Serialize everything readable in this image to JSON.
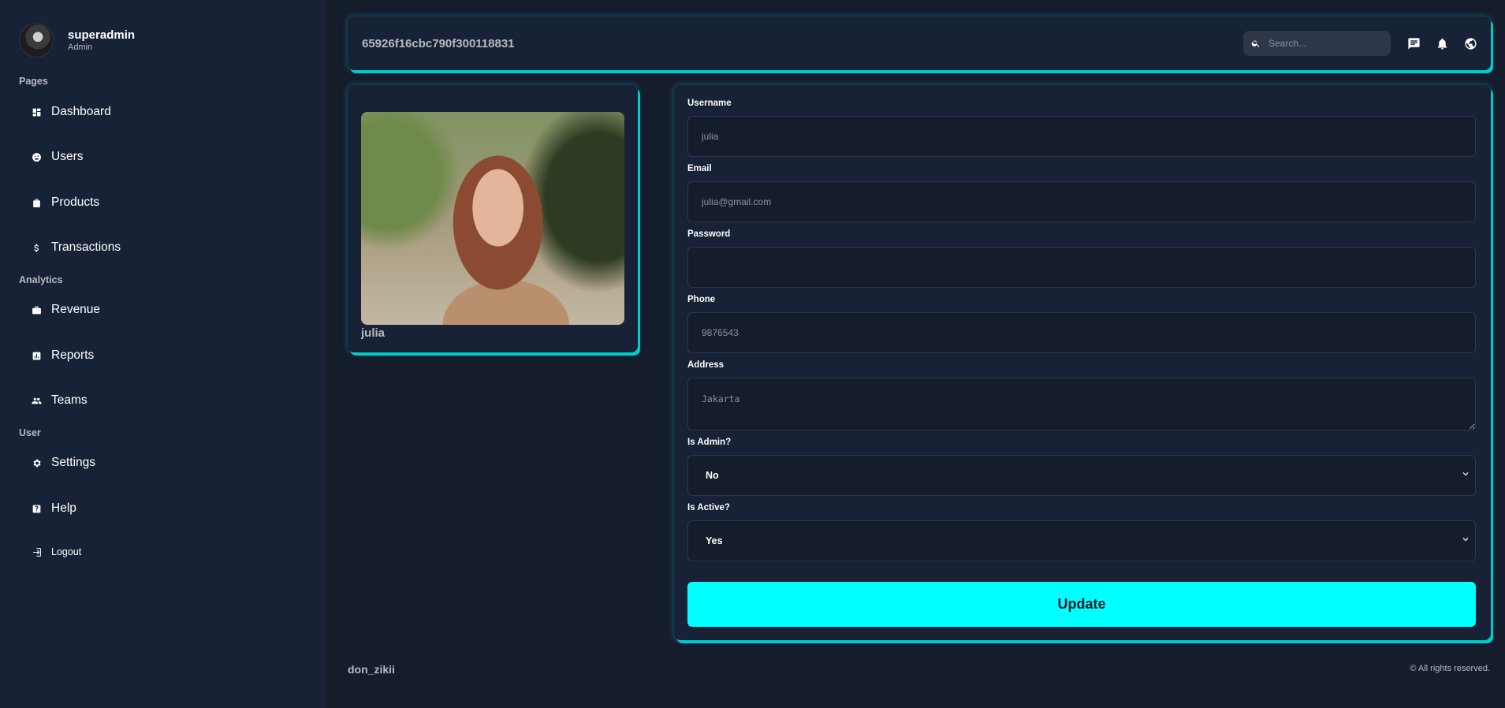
{
  "sidebar": {
    "user": {
      "name": "superadmin",
      "role": "Admin"
    },
    "sections": [
      {
        "title": "Pages",
        "items": [
          {
            "label": "Dashboard",
            "icon": "dashboard-icon"
          },
          {
            "label": "Users",
            "icon": "users-icon"
          },
          {
            "label": "Products",
            "icon": "shopping-bag-icon"
          },
          {
            "label": "Transactions",
            "icon": "dollar-icon"
          }
        ]
      },
      {
        "title": "Analytics",
        "items": [
          {
            "label": "Revenue",
            "icon": "briefcase-icon"
          },
          {
            "label": "Reports",
            "icon": "analytics-icon"
          },
          {
            "label": "Teams",
            "icon": "people-icon"
          }
        ]
      },
      {
        "title": "User",
        "items": [
          {
            "label": "Settings",
            "icon": "gear-icon"
          },
          {
            "label": "Help",
            "icon": "help-icon"
          }
        ]
      }
    ],
    "logout": {
      "label": "Logout",
      "icon": "logout-icon"
    }
  },
  "topbar": {
    "title": "65926f16cbc790f300118831",
    "search_placeholder": "Search...",
    "icons": [
      "chat-icon",
      "bell-icon",
      "globe-icon"
    ]
  },
  "image_card": {
    "caption": "julia"
  },
  "form": {
    "username": {
      "label": "Username",
      "placeholder": "julia"
    },
    "email": {
      "label": "Email",
      "placeholder": "julia@gmail.com"
    },
    "password": {
      "label": "Password",
      "placeholder": ""
    },
    "phone": {
      "label": "Phone",
      "placeholder": "9876543"
    },
    "address": {
      "label": "Address",
      "placeholder": "Jakarta"
    },
    "is_admin": {
      "label": "Is Admin?",
      "value": "No"
    },
    "is_active": {
      "label": "Is Active?",
      "value": "Yes"
    },
    "submit_label": "Update"
  },
  "footer": {
    "brand": "don_zikii",
    "copyright": "© All rights reserved."
  },
  "colors": {
    "background": "#151c2c",
    "panel": "#182237",
    "accent": "#00ffff",
    "muted_text": "#b7bac1"
  }
}
